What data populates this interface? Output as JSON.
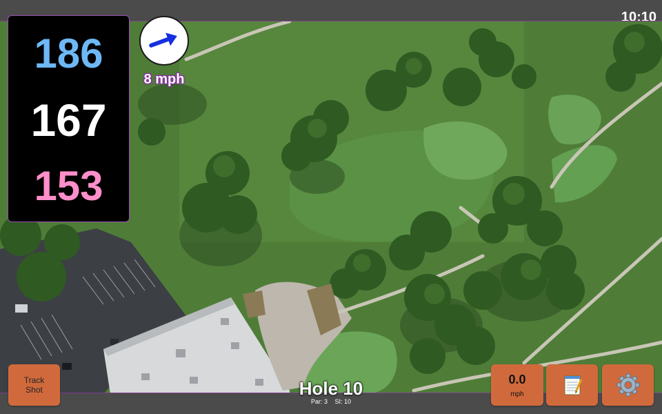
{
  "status": {
    "clock": "10:10"
  },
  "distances": {
    "back": "186",
    "middle": "167",
    "front": "153"
  },
  "wind": {
    "speed_label": "8 mph",
    "direction": "arrow pointing east-northeast"
  },
  "buttons": {
    "track_shot": [
      "Track",
      "Shot"
    ],
    "speed_value": "0.0",
    "speed_unit": "mph",
    "notes_icon": "notepad-icon",
    "settings_icon": "gear-icon"
  },
  "hole": {
    "title": "Hole 10",
    "par": "Par: 3",
    "si": "SI: 10"
  },
  "colors": {
    "panel_border": "#9a4fb5",
    "back_distance": "#6db8f5",
    "middle_distance": "#ffffff",
    "front_distance": "#ff8fca",
    "button": "#d06a3c",
    "wind_arrow": "#1530e0"
  }
}
